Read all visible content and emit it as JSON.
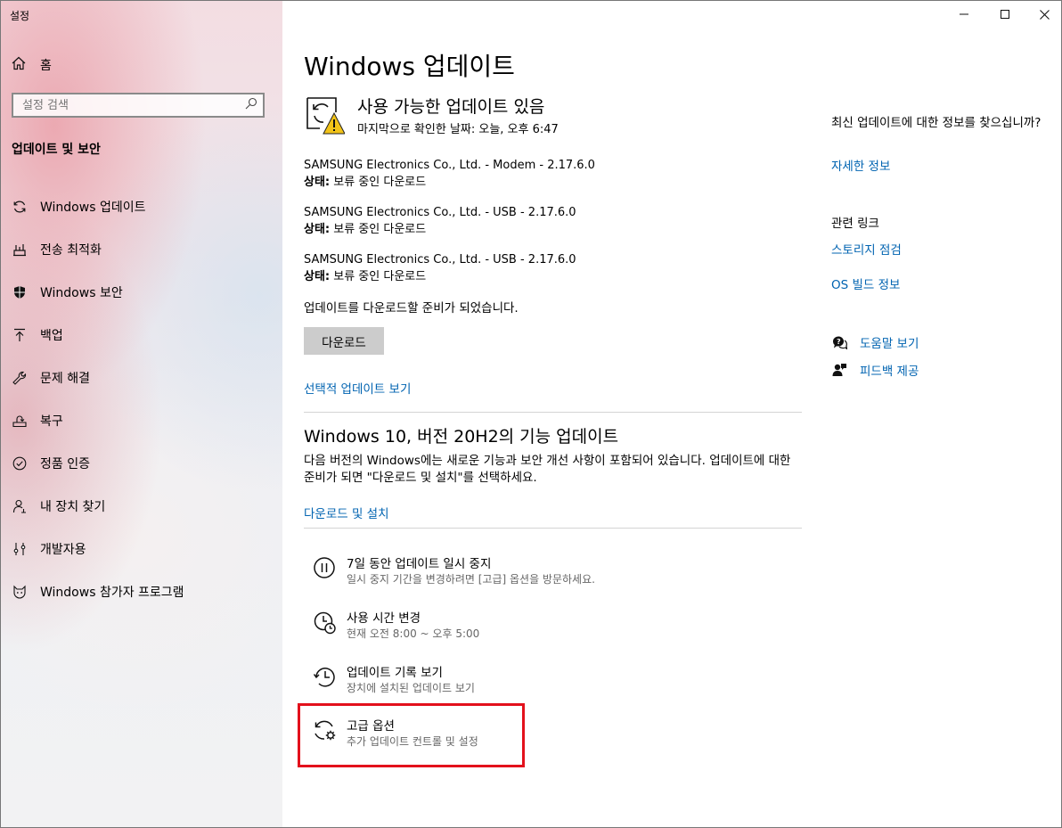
{
  "app": {
    "title": "설정"
  },
  "sidebar": {
    "home_label": "홈",
    "search_placeholder": "설정 검색",
    "section_label": "업데이트 및 보안",
    "items": [
      {
        "label": "Windows 업데이트",
        "icon": "sync-icon"
      },
      {
        "label": "전송 최적화",
        "icon": "delivery-icon"
      },
      {
        "label": "Windows 보안",
        "icon": "shield-icon"
      },
      {
        "label": "백업",
        "icon": "upload-icon"
      },
      {
        "label": "문제 해결",
        "icon": "wrench-icon"
      },
      {
        "label": "복구",
        "icon": "recovery-icon"
      },
      {
        "label": "정품 인증",
        "icon": "check-circle-icon"
      },
      {
        "label": "내 장치 찾기",
        "icon": "person-pin-icon"
      },
      {
        "label": "개발자용",
        "icon": "developer-icon"
      },
      {
        "label": "Windows 참가자 프로그램",
        "icon": "insider-cat-icon"
      }
    ]
  },
  "main": {
    "title": "Windows 업데이트",
    "status_title": "사용 가능한 업데이트 있음",
    "status_sub": "마지막으로 확인한 날짜: 오늘, 오후 6:47",
    "updates": [
      {
        "name": "SAMSUNG Electronics Co., Ltd.  - Modem - 2.17.6.0",
        "status_label": "상태:",
        "status_value": " 보류 중인 다운로드"
      },
      {
        "name": "SAMSUNG Electronics Co., Ltd. - USB - 2.17.6.0",
        "status_label": "상태:",
        "status_value": " 보류 중인 다운로드"
      },
      {
        "name": "SAMSUNG Electronics Co., Ltd.  - USB - 2.17.6.0",
        "status_label": "상태:",
        "status_value": " 보류 중인 다운로드"
      }
    ],
    "ready_text": "업데이트를 다운로드할 준비가 되었습니다.",
    "download_button": "다운로드",
    "optional_link": "선택적 업데이트 보기",
    "feature_title": "Windows 10, 버전 20H2의 기능 업데이트",
    "feature_desc": "다음 버전의 Windows에는 새로운 기능과 보안 개선 사항이 포함되어 있습니다. 업데이트에 대한 준비가 되면 \"다운로드 및 설치\"를 선택하세요.",
    "feature_link": "다운로드 및 설치",
    "options": [
      {
        "title": "7일 동안 업데이트 일시 중지",
        "sub": "일시 중지 기간을 변경하려면 [고급] 옵션을 방문하세요.",
        "icon": "pause-icon"
      },
      {
        "title": "사용 시간 변경",
        "sub": "현재 오전 8:00 ~ 오후 5:00",
        "icon": "clock-icon"
      },
      {
        "title": "업데이트 기록 보기",
        "sub": "장치에 설치된 업데이트 보기",
        "icon": "history-icon"
      },
      {
        "title": "고급 옵션",
        "sub": "추가 업데이트 컨트롤 및 설정",
        "icon": "sync-gear-icon"
      }
    ]
  },
  "right": {
    "info_text": "최신 업데이트에 대한 정보를 찾으십니까?",
    "info_link": "자세한 정보",
    "related_title": "관련 링크",
    "related_links": [
      "스토리지 점검",
      "OS 빌드 정보"
    ],
    "help_link": "도움말 보기",
    "feedback_link": "피드백 제공"
  },
  "colors": {
    "link": "#0063b1",
    "highlight": "#e3111c",
    "button": "#cccccc"
  }
}
